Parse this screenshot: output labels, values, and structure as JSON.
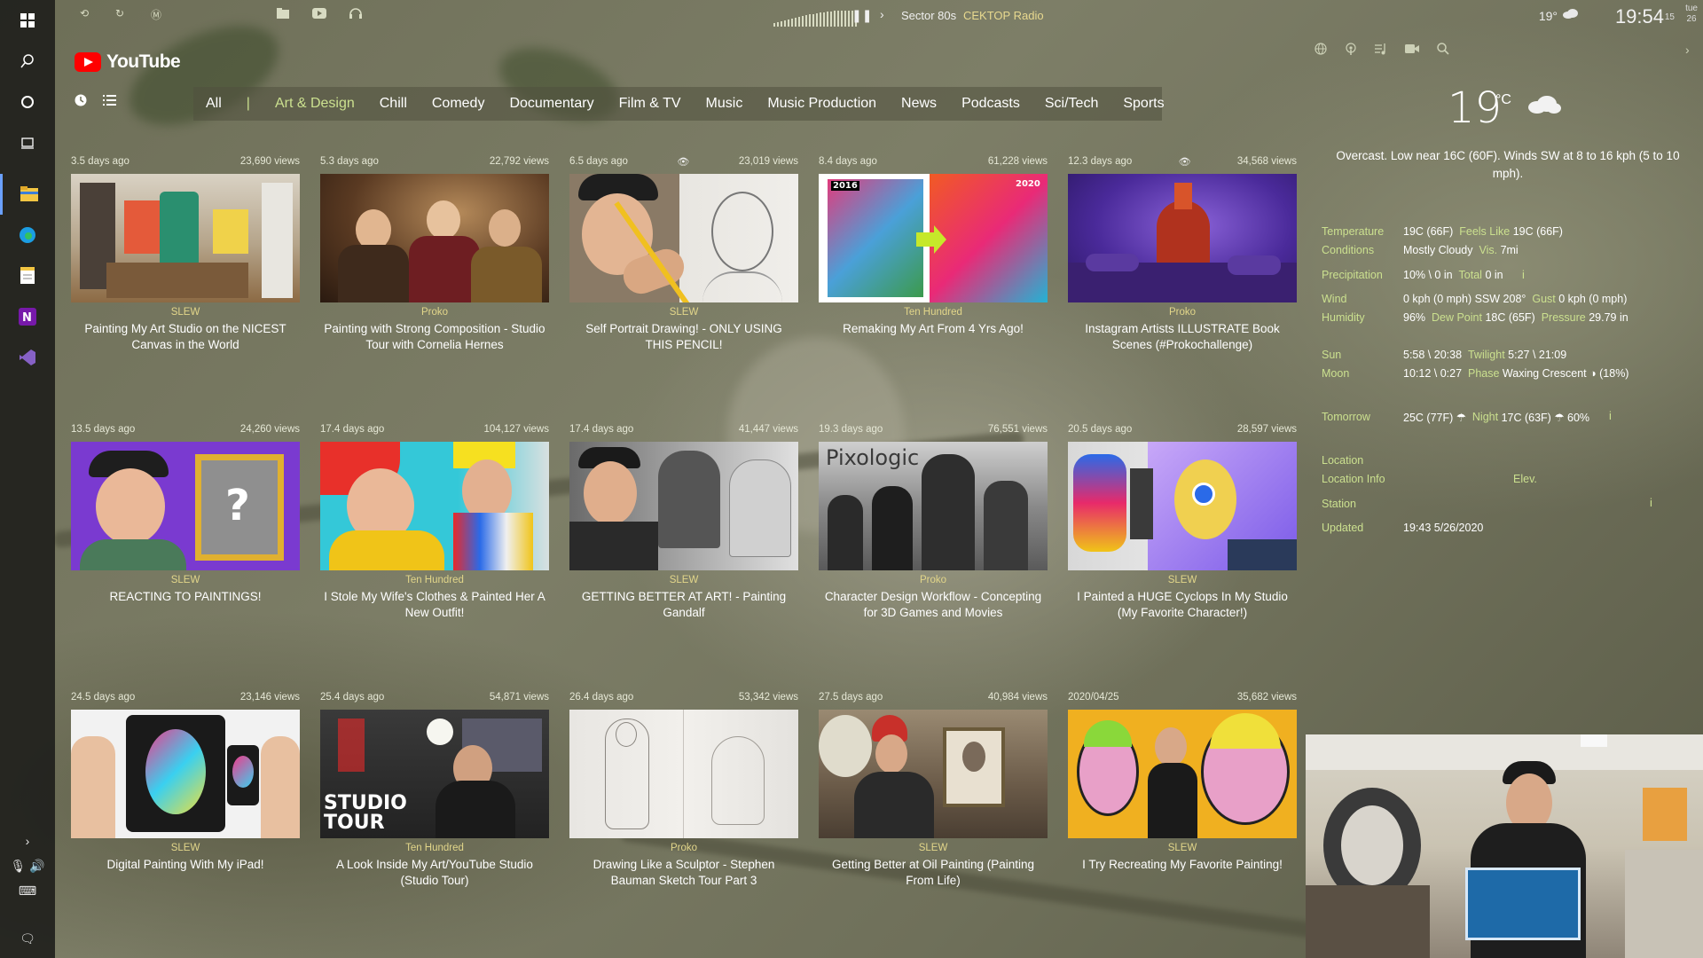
{
  "topbar": {
    "radio_track": "Sector 80s",
    "radio_station": "CEKTOP Radio",
    "temp": "19°",
    "time": "19:54",
    "seconds": "15",
    "day_name": "tue",
    "day_num": "26"
  },
  "youtube": {
    "logo_text": "YouTube",
    "categories": [
      "All",
      "Art & Design",
      "Chill",
      "Comedy",
      "Documentary",
      "Film & TV",
      "Music",
      "Music Production",
      "News",
      "Podcasts",
      "Sci/Tech",
      "Sports"
    ],
    "separator": "|",
    "videos": [
      {
        "age": "3.5 days ago",
        "views": "23,690 views",
        "channel": "SLEW",
        "title": "Painting My Art Studio on the NICEST Canvas in the World"
      },
      {
        "age": "5.3 days ago",
        "views": "22,792 views",
        "channel": "Proko",
        "title": "Painting with Strong Composition - Studio Tour with Cornelia Hernes"
      },
      {
        "age": "6.5 days ago",
        "views": "23,019 views",
        "channel": "SLEW",
        "title": "Self Portrait Drawing! - ONLY USING THIS PENCIL!"
      },
      {
        "age": "8.4 days ago",
        "views": "61,228 views",
        "channel": "Ten Hundred",
        "title": "Remaking My Art From 4 Yrs Ago!"
      },
      {
        "age": "12.3 days ago",
        "views": "34,568 views",
        "channel": "Proko",
        "title": "Instagram Artists ILLUSTRATE Book Scenes (#Prokochallenge)"
      },
      {
        "age": "13.5 days ago",
        "views": "24,260 views",
        "channel": "SLEW",
        "title": "REACTING TO PAINTINGS!"
      },
      {
        "age": "17.4 days ago",
        "views": "104,127 views",
        "channel": "Ten Hundred",
        "title": "I Stole My Wife's Clothes & Painted Her A New Outfit!"
      },
      {
        "age": "17.4 days ago",
        "views": "41,447 views",
        "channel": "SLEW",
        "title": "GETTING BETTER AT ART! - Painting Gandalf"
      },
      {
        "age": "19.3 days ago",
        "views": "76,551 views",
        "channel": "Proko",
        "title": "Character Design Workflow - Concepting for 3D Games and Movies"
      },
      {
        "age": "20.5 days ago",
        "views": "28,597 views",
        "channel": "SLEW",
        "title": "I Painted a HUGE Cyclops In My Studio (My Favorite Character!)"
      },
      {
        "age": "24.5 days ago",
        "views": "23,146 views",
        "channel": "SLEW",
        "title": "Digital Painting With My iPad!"
      },
      {
        "age": "25.4 days ago",
        "views": "54,871 views",
        "channel": "Ten Hundred",
        "title": "A Look Inside My Art/YouTube Studio (Studio Tour)"
      },
      {
        "age": "26.4 days ago",
        "views": "53,342 views",
        "channel": "Proko",
        "title": "Drawing Like a Sculptor - Stephen Bauman Sketch Tour Part 3"
      },
      {
        "age": "27.5 days ago",
        "views": "40,984 views",
        "channel": "SLEW",
        "title": "Getting Better at Oil Painting (Painting From Life)"
      },
      {
        "age": "2020/04/25",
        "views": "35,682 views",
        "channel": "SLEW",
        "title": "I Try Recreating My Favorite Painting!"
      }
    ],
    "thumb_text": {
      "year_left": "2016",
      "year_right": "2020",
      "pixologic": "Pixologic",
      "studio_tour_1": "STUDIO",
      "studio_tour_2": "TOUR",
      "question": "?"
    }
  },
  "weather": {
    "temp_big": "19",
    "unit": "°C",
    "description": "Overcast. Low near 16C (60F). Winds SW at 8 to 16 kph (5 to 10 mph).",
    "rows": {
      "temperature": {
        "label": "Temperature",
        "value": "19C (66F)",
        "k2": "Feels Like",
        "v2": "19C (66F)"
      },
      "conditions": {
        "label": "Conditions",
        "value": "Mostly Cloudy",
        "k2": "Vis.",
        "v2": "7mi"
      },
      "precipitation": {
        "label": "Precipitation",
        "value": "10% \\ 0 in",
        "k2": "Total",
        "v2": "0 in"
      },
      "wind": {
        "label": "Wind",
        "value": "0 kph (0 mph) SSW 208°",
        "k2": "Gust",
        "v2": "0 kph (0 mph)"
      },
      "humidity": {
        "label": "Humidity",
        "value": "96%",
        "k2": "Dew Point",
        "v2": "18C (65F)",
        "k3": "Pressure",
        "v3": "29.79 in"
      },
      "sun": {
        "label": "Sun",
        "value": "5:58 \\ 20:38",
        "k2": "Twilight",
        "v2": "5:27 \\ 21:09"
      },
      "moon": {
        "label": "Moon",
        "value": "10:12 \\ 0:27",
        "k2": "Phase",
        "v2": "Waxing Crescent ◑ (18%)"
      },
      "tomorrow": {
        "label": "Tomorrow",
        "value": "25C (77F) ☂",
        "k2": "Night",
        "v2": "17C (63F) ☂ 60%"
      },
      "location": {
        "label": "Location"
      },
      "location_info": {
        "label": "Location Info",
        "k2": "Elev."
      },
      "station": {
        "label": "Station"
      },
      "updated": {
        "label": "Updated",
        "value": "19:43 5/26/2020"
      }
    },
    "info_glyph": "i"
  },
  "icons": {
    "taskbar": [
      "windows-icon",
      "search-icon",
      "cortana-icon",
      "task-view-icon",
      "file-explorer-icon",
      "edge-icon",
      "notepad-icon",
      "onenote-icon",
      "visual-studio-icon"
    ],
    "accent": "#cbe08f",
    "channel_color": "#e2d68a"
  }
}
